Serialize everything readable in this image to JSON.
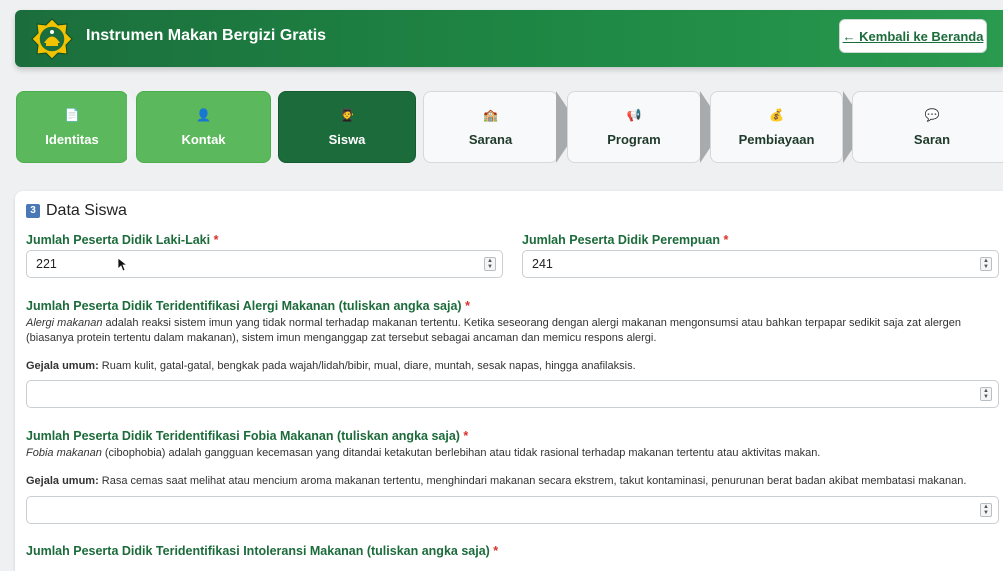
{
  "header": {
    "title": "Instrumen Makan Bergizi Gratis",
    "back_label": "← Kembali ke Beranda"
  },
  "steps": [
    {
      "icon": "document-icon",
      "glyph": "📄",
      "label": "Identitas",
      "state": "done"
    },
    {
      "icon": "person-icon",
      "glyph": "👤",
      "label": "Kontak",
      "state": "done"
    },
    {
      "icon": "graduate-icon",
      "glyph": "🧑‍🎓",
      "label": "Siswa",
      "state": "active"
    },
    {
      "icon": "school-icon",
      "glyph": "🏫",
      "label": "Sarana",
      "state": "todo"
    },
    {
      "icon": "megaphone-icon",
      "glyph": "📢",
      "label": "Program",
      "state": "todo"
    },
    {
      "icon": "money-bag-icon",
      "glyph": "💰",
      "label": "Pembiayaan",
      "state": "todo"
    },
    {
      "icon": "speech-bubble-icon",
      "glyph": "💬",
      "label": "Saran",
      "state": "todo"
    }
  ],
  "section": {
    "number": "3",
    "title": "Data Siswa"
  },
  "fields": {
    "laki": {
      "label": "Jumlah Peserta Didik Laki-Laki",
      "value": "221"
    },
    "perempuan": {
      "label": "Jumlah Peserta Didik Perempuan",
      "value": "241"
    },
    "alergi": {
      "label": "Jumlah Peserta Didik Teridentifikasi Alergi Makanan (tuliskan angka saja)",
      "term": "Alergi makanan",
      "desc": " adalah reaksi sistem imun yang tidak normal terhadap makanan tertentu. Ketika seseorang dengan alergi makanan mengonsumsi atau bahkan terpapar sedikit saja zat alergen (biasanya protein tertentu dalam makanan), sistem imun menganggap zat tersebut sebagai ancaman dan memicu respons alergi.",
      "symptom_label": "Gejala umum:",
      "symptoms": " Ruam kulit, gatal-gatal, bengkak pada wajah/lidah/bibir, mual, diare, muntah, sesak napas, hingga anafilaksis.",
      "value": ""
    },
    "fobia": {
      "label": "Jumlah Peserta Didik Teridentifikasi Fobia Makanan (tuliskan angka saja)",
      "term": "Fobia makanan",
      "desc": " (cibophobia) adalah gangguan kecemasan yang ditandai ketakutan berlebihan atau tidak rasional terhadap makanan tertentu atau aktivitas makan.",
      "symptom_label": "Gejala umum:",
      "symptoms": " Rasa cemas saat melihat atau mencium aroma makanan tertentu, menghindari makanan secara ekstrem, takut kontaminasi, penurunan berat badan akibat membatasi makanan.",
      "value": ""
    },
    "intoleransi": {
      "label": "Jumlah Peserta Didik Teridentifikasi Intoleransi Makanan (tuliskan angka saja)"
    }
  },
  "required_mark": "*",
  "colors": {
    "primary": "#1c6b3b",
    "done": "#5cb85c",
    "required": "#d9302c"
  }
}
